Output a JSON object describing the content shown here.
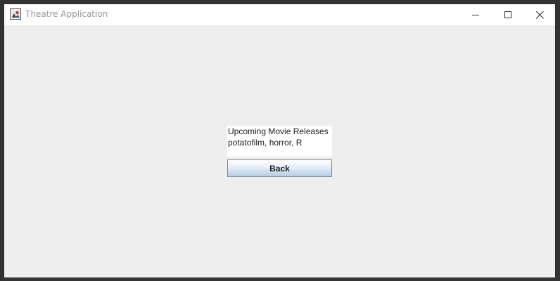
{
  "window": {
    "title": "Theatre Application",
    "controls": {
      "minimize_icon": "minimize-icon",
      "maximize_icon": "maximize-icon",
      "close_icon": "close-icon"
    }
  },
  "content": {
    "lines": [
      "Upcoming Movie Releases",
      "potatofilm, horror, R"
    ],
    "back_label": "Back"
  },
  "colors": {
    "background": "#eeeeee",
    "titlebar": "#ffffff",
    "title_text": "#999999",
    "panel": "#ffffff"
  }
}
